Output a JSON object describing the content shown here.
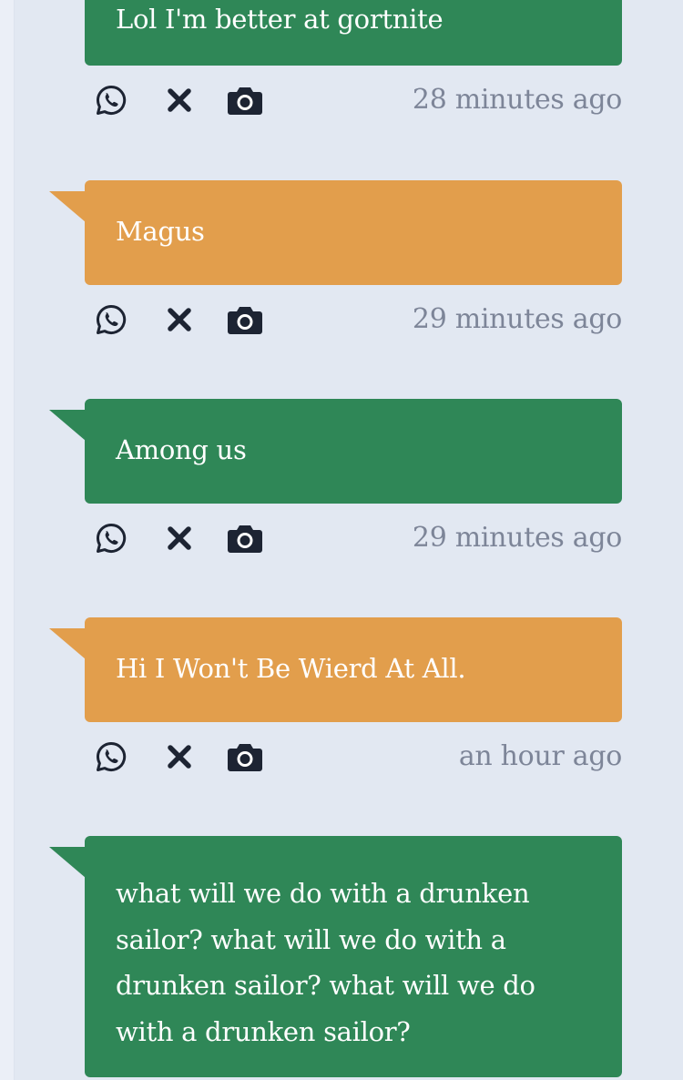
{
  "colors": {
    "background": "#e2e8f2",
    "green_bubble": "#2f8757",
    "orange_bubble": "#e29e4c",
    "icon": "#1d2433",
    "timestamp": "#7d8598"
  },
  "posts": [
    {
      "text": "Lol I'm better at gortnite",
      "color": "green",
      "time": "28 minutes ago",
      "actions": [
        "whatsapp-icon",
        "close-icon",
        "camera-icon"
      ]
    },
    {
      "text": "Magus",
      "color": "orange",
      "time": "29 minutes ago",
      "actions": [
        "whatsapp-icon",
        "close-icon",
        "camera-icon"
      ]
    },
    {
      "text": "Among us",
      "color": "green",
      "time": "29 minutes ago",
      "actions": [
        "whatsapp-icon",
        "close-icon",
        "camera-icon"
      ]
    },
    {
      "text": "Hi I Won't Be Wierd At All.",
      "color": "orange",
      "time": "an hour ago",
      "actions": [
        "whatsapp-icon",
        "close-icon",
        "camera-icon"
      ]
    },
    {
      "text": "what will we do with a drunken sailor? what will we do with a drunken sailor? what will we do with a drunken sailor?",
      "color": "green",
      "time": "",
      "actions": []
    }
  ]
}
